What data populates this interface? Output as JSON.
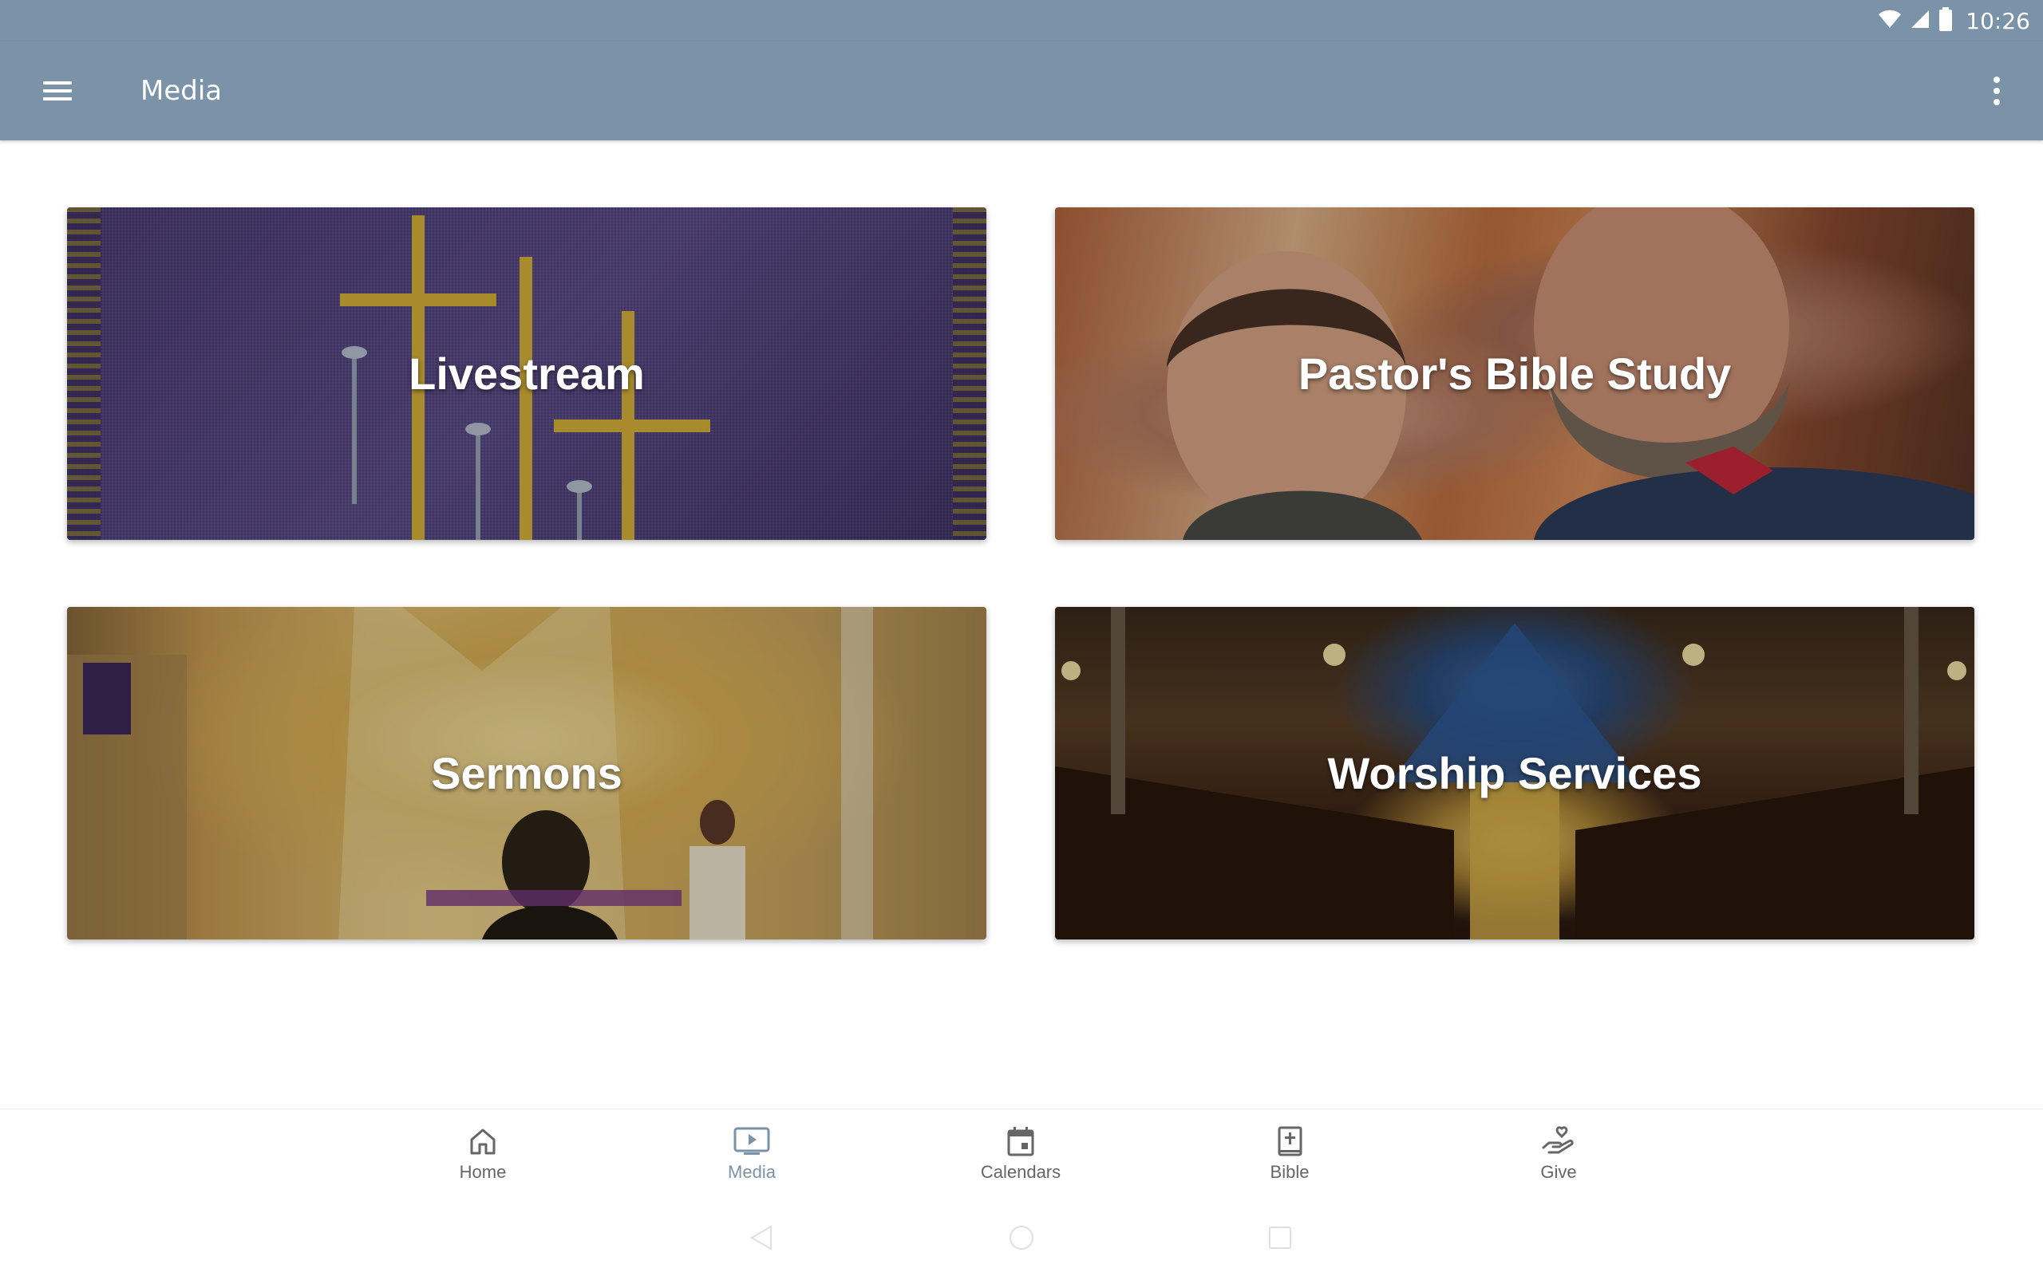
{
  "status_bar": {
    "time": "10:26",
    "icons": [
      "wifi-icon",
      "cell-signal-icon",
      "battery-icon"
    ]
  },
  "app_bar": {
    "title": "Media",
    "menu_icon": "hamburger-menu-icon",
    "more_icon": "more-vert-icon"
  },
  "tiles": [
    {
      "label": "Livestream"
    },
    {
      "label": "Pastor's Bible Study"
    },
    {
      "label": "Sermons"
    },
    {
      "label": "Worship Services"
    }
  ],
  "bottom_nav": {
    "active_color": "#7a93a8",
    "items": [
      {
        "label": "Home",
        "icon": "home-icon"
      },
      {
        "label": "Media",
        "icon": "media-icon",
        "active": true
      },
      {
        "label": "Calendars",
        "icon": "calendar-icon"
      },
      {
        "label": "Bible",
        "icon": "bible-icon"
      },
      {
        "label": "Give",
        "icon": "give-icon"
      }
    ]
  },
  "colors": {
    "app_bar": "#7a93a8",
    "inactive_nav": "#666666"
  }
}
